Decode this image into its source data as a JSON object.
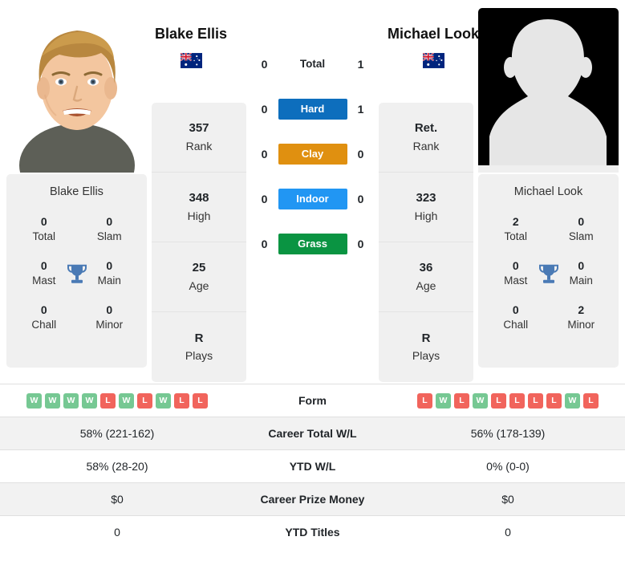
{
  "players": {
    "left": {
      "name": "Blake Ellis",
      "flag": "australia-flag",
      "caption": "Blake Ellis",
      "rank": "357",
      "rank_label": "Rank",
      "high": "348",
      "high_label": "High",
      "age": "25",
      "age_label": "Age",
      "plays": "R",
      "plays_label": "Plays",
      "titles": [
        {
          "num": "0",
          "label": "Total"
        },
        {
          "num": "0",
          "label": "Slam"
        },
        {
          "num": "0",
          "label": "Mast"
        },
        {
          "num": "0",
          "label": "Main"
        },
        {
          "num": "0",
          "label": "Chall"
        },
        {
          "num": "0",
          "label": "Minor"
        }
      ],
      "form": [
        "W",
        "W",
        "W",
        "W",
        "L",
        "W",
        "L",
        "W",
        "L",
        "L"
      ],
      "career_wl": "58% (221-162)",
      "ytd_wl": "58% (28-20)",
      "prize_money": "$0",
      "ytd_titles": "0"
    },
    "right": {
      "name": "Michael Look",
      "flag": "australia-flag",
      "caption": "Michael Look",
      "rank": "Ret.",
      "rank_label": "Rank",
      "high": "323",
      "high_label": "High",
      "age": "36",
      "age_label": "Age",
      "plays": "R",
      "plays_label": "Plays",
      "titles": [
        {
          "num": "2",
          "label": "Total"
        },
        {
          "num": "0",
          "label": "Slam"
        },
        {
          "num": "0",
          "label": "Mast"
        },
        {
          "num": "0",
          "label": "Main"
        },
        {
          "num": "0",
          "label": "Chall"
        },
        {
          "num": "2",
          "label": "Minor"
        }
      ],
      "form": [
        "L",
        "W",
        "L",
        "W",
        "L",
        "L",
        "L",
        "L",
        "W",
        "L"
      ],
      "career_wl": "56% (178-139)",
      "ytd_wl": "0% (0-0)",
      "prize_money": "$0",
      "ytd_titles": "0"
    }
  },
  "surfaces": [
    {
      "label": "Total",
      "left": "0",
      "right": "1",
      "color": "transparent",
      "plain": true
    },
    {
      "label": "Hard",
      "left": "0",
      "right": "1",
      "color": "#0d6ebd"
    },
    {
      "label": "Clay",
      "left": "0",
      "right": "0",
      "color": "#e09010"
    },
    {
      "label": "Indoor",
      "left": "0",
      "right": "0",
      "color": "#2196f3"
    },
    {
      "label": "Grass",
      "left": "0",
      "right": "0",
      "color": "#0a9442"
    }
  ],
  "table_rows": [
    {
      "label": "Form",
      "key": "form",
      "type": "form"
    },
    {
      "label": "Career Total W/L",
      "key": "career_wl",
      "type": "text"
    },
    {
      "label": "YTD W/L",
      "key": "ytd_wl",
      "type": "text"
    },
    {
      "label": "Career Prize Money",
      "key": "prize_money",
      "type": "text"
    },
    {
      "label": "YTD Titles",
      "key": "ytd_titles",
      "type": "text"
    }
  ],
  "colors": {
    "hard": "#0d6ebd",
    "clay": "#e09010",
    "indoor": "#2196f3",
    "grass": "#0a9442",
    "win_badge": "#76c893",
    "loss_badge": "#f1645c",
    "card_bg": "#f0f0f0",
    "row_alt_bg": "#f2f2f2"
  }
}
